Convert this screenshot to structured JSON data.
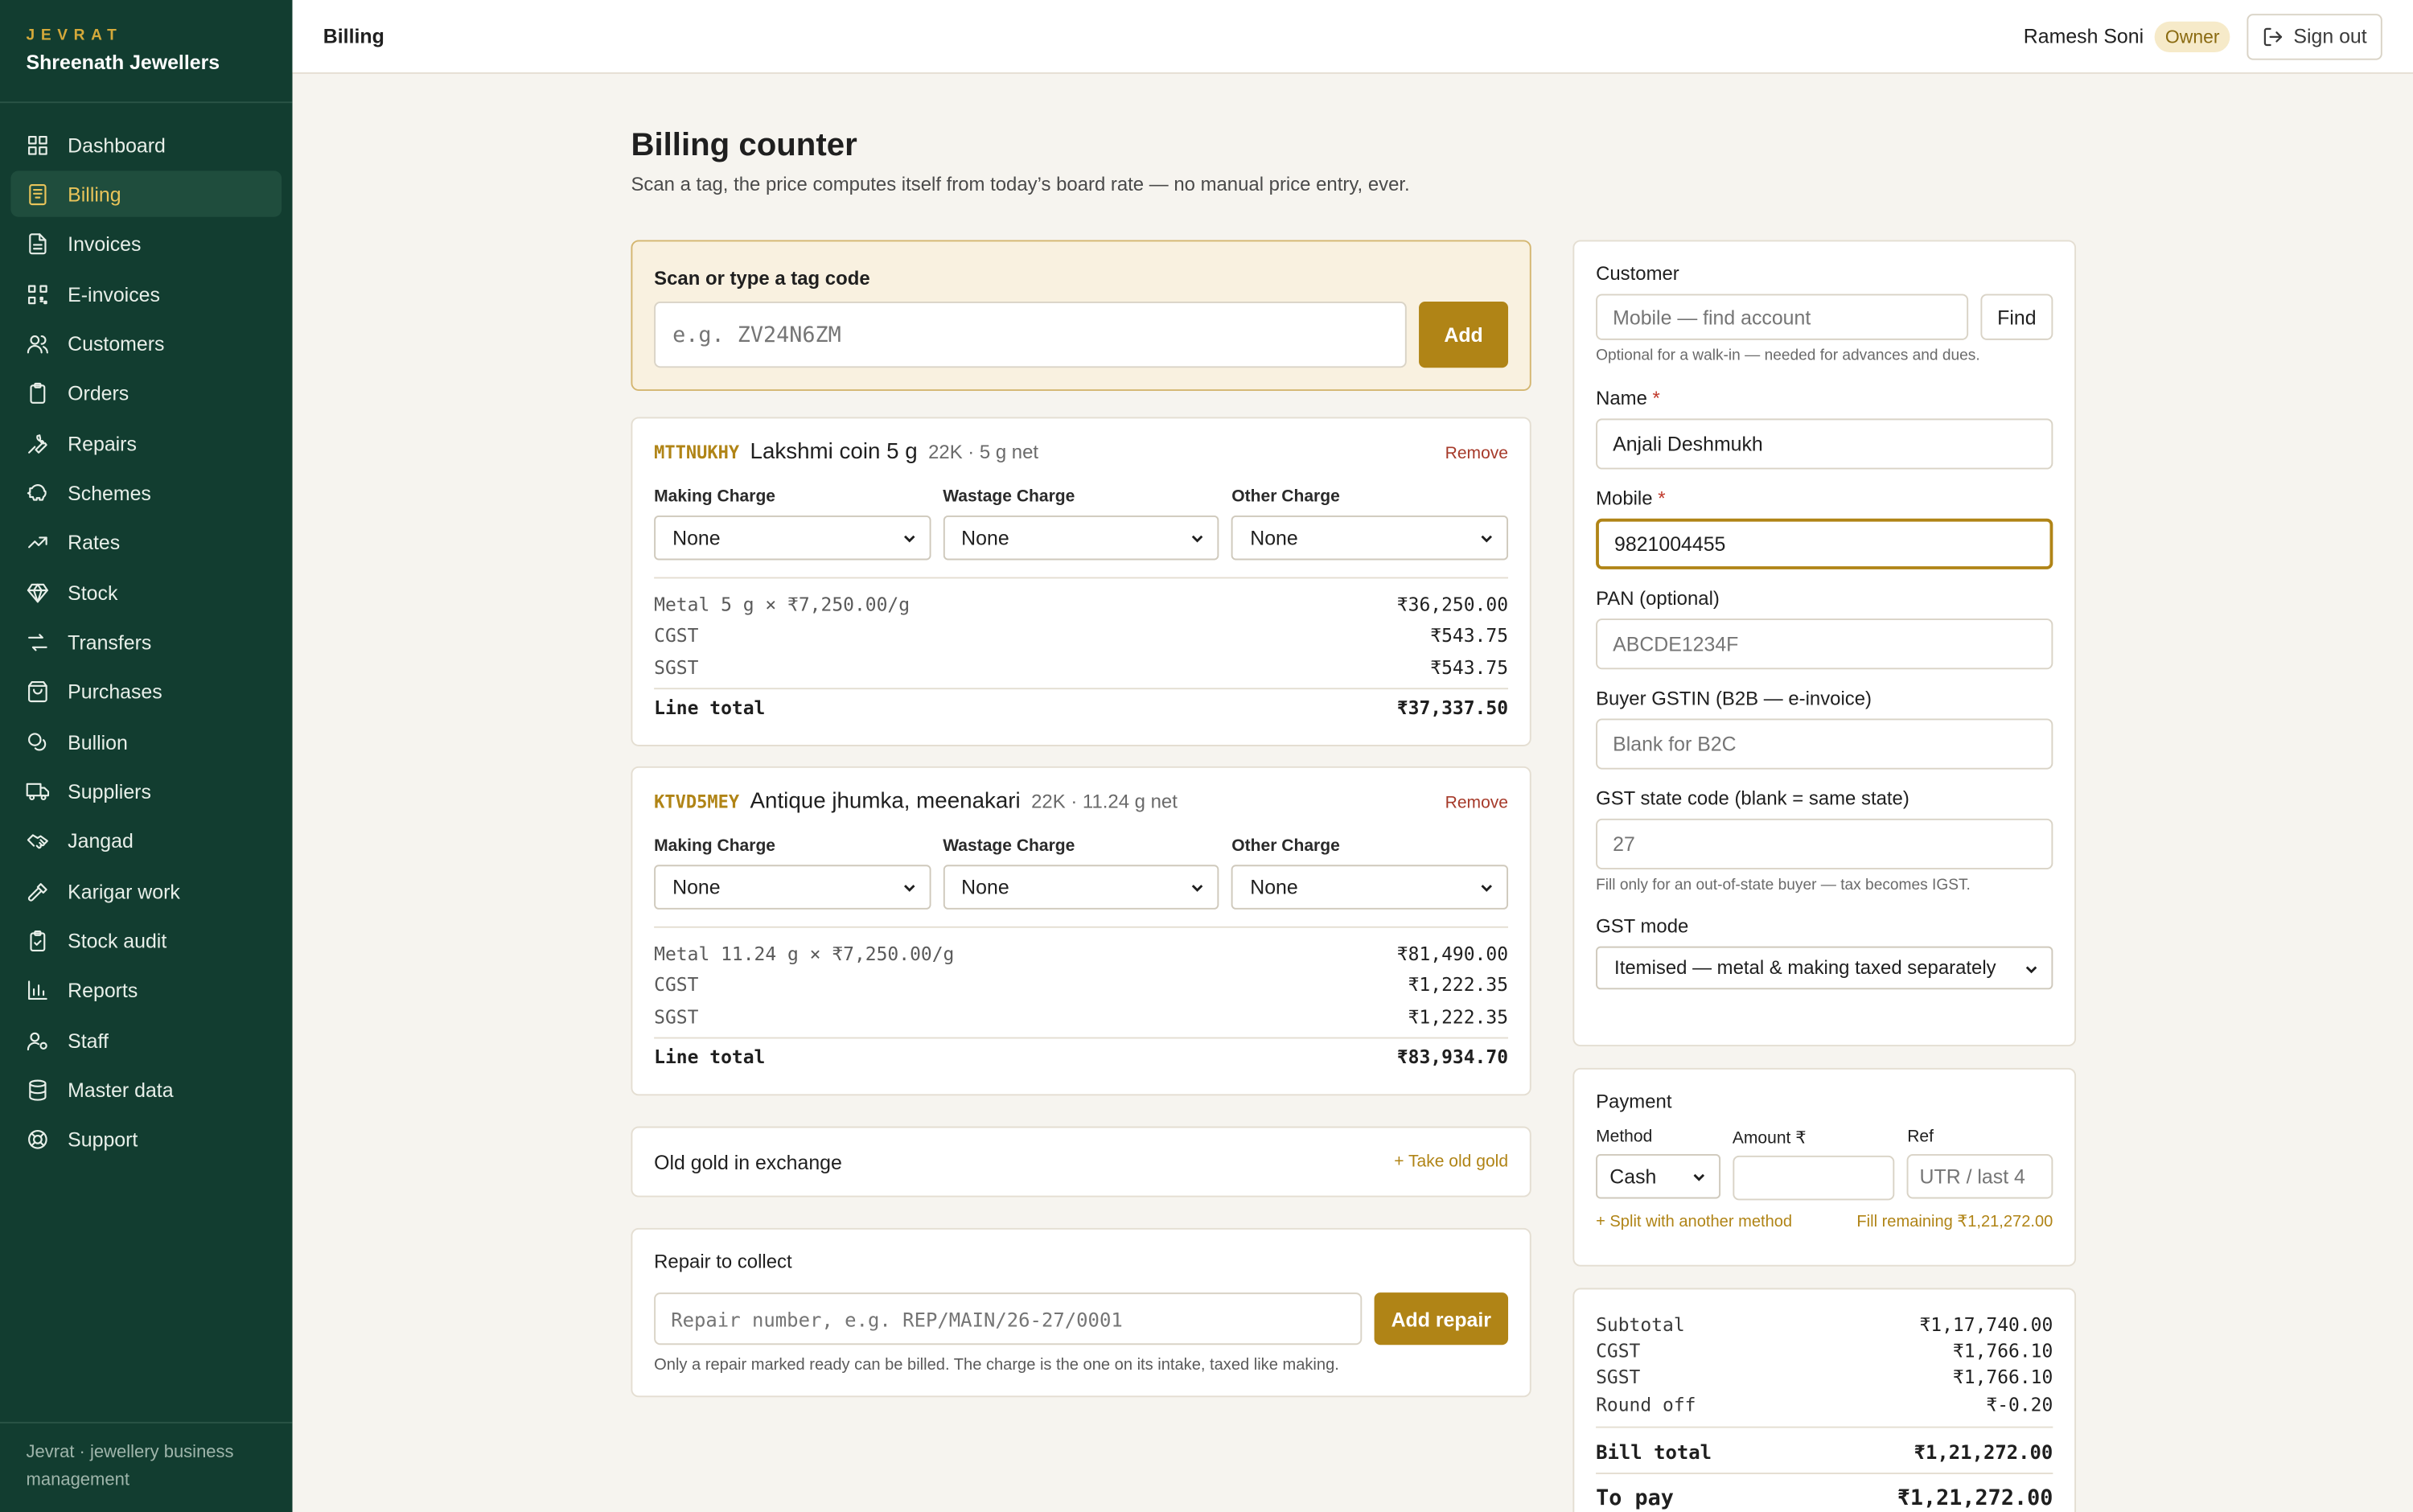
{
  "brand": {
    "mark": "JEVRAT",
    "name": "Shreenath Jewellers",
    "footer": "Jevrat · jewellery business management"
  },
  "nav": [
    {
      "label": "Dashboard",
      "icon": "dashboard-icon"
    },
    {
      "label": "Billing",
      "icon": "billing-icon",
      "active": true
    },
    {
      "label": "Invoices",
      "icon": "invoice-icon"
    },
    {
      "label": "E-invoices",
      "icon": "qr-icon"
    },
    {
      "label": "Customers",
      "icon": "users-icon"
    },
    {
      "label": "Orders",
      "icon": "clipboard-icon"
    },
    {
      "label": "Repairs",
      "icon": "wrench-icon"
    },
    {
      "label": "Schemes",
      "icon": "piggy-bank-icon"
    },
    {
      "label": "Rates",
      "icon": "trending-up-icon"
    },
    {
      "label": "Stock",
      "icon": "gem-icon"
    },
    {
      "label": "Transfers",
      "icon": "arrows-icon"
    },
    {
      "label": "Purchases",
      "icon": "shopping-bag-icon"
    },
    {
      "label": "Bullion",
      "icon": "coins-icon"
    },
    {
      "label": "Suppliers",
      "icon": "truck-icon"
    },
    {
      "label": "Jangad",
      "icon": "handshake-icon"
    },
    {
      "label": "Karigar work",
      "icon": "hammer-icon"
    },
    {
      "label": "Stock audit",
      "icon": "clipboard-check-icon"
    },
    {
      "label": "Reports",
      "icon": "bar-chart-icon"
    },
    {
      "label": "Staff",
      "icon": "user-cog-icon"
    },
    {
      "label": "Master data",
      "icon": "database-icon"
    },
    {
      "label": "Support",
      "icon": "lifebuoy-icon"
    }
  ],
  "topbar": {
    "title": "Billing",
    "user": "Ramesh Soni",
    "role": "Owner",
    "signout": "Sign out"
  },
  "page": {
    "title": "Billing counter",
    "subtitle": "Scan a tag, the price computes itself from today’s board rate — no manual price entry, ever."
  },
  "scan": {
    "label": "Scan or type a tag code",
    "placeholder": "e.g. ZV24N6ZM",
    "button": "Add"
  },
  "items": [
    {
      "tag": "MTTNUKHY",
      "name": "Lakshmi coin 5 g",
      "meta": "22K · 5 g net",
      "remove": "Remove",
      "charges": [
        {
          "label": "Making Charge",
          "value": "None"
        },
        {
          "label": "Wastage Charge",
          "value": "None"
        },
        {
          "label": "Other Charge",
          "value": "None"
        }
      ],
      "lines": [
        {
          "label": "Metal 5 g × ₹7,250.00/g",
          "value": "₹36,250.00"
        },
        {
          "label": "CGST",
          "value": "₹543.75"
        },
        {
          "label": "SGST",
          "value": "₹543.75"
        }
      ],
      "total_label": "Line total",
      "total": "₹37,337.50"
    },
    {
      "tag": "KTVD5MEY",
      "name": "Antique jhumka, meenakari",
      "meta": "22K · 11.24 g net",
      "remove": "Remove",
      "charges": [
        {
          "label": "Making Charge",
          "value": "None"
        },
        {
          "label": "Wastage Charge",
          "value": "None"
        },
        {
          "label": "Other Charge",
          "value": "None"
        }
      ],
      "lines": [
        {
          "label": "Metal 11.24 g × ₹7,250.00/g",
          "value": "₹81,490.00"
        },
        {
          "label": "CGST",
          "value": "₹1,222.35"
        },
        {
          "label": "SGST",
          "value": "₹1,222.35"
        }
      ],
      "total_label": "Line total",
      "total": "₹83,934.70"
    }
  ],
  "oldgold": {
    "title": "Old gold in exchange",
    "link": "+ Take old gold"
  },
  "repair": {
    "title": "Repair to collect",
    "placeholder": "Repair number, e.g. REP/MAIN/26-27/0001",
    "button": "Add repair",
    "hint": "Only a repair marked ready can be billed. The charge is the one on its intake, taxed like making."
  },
  "customer": {
    "title": "Customer",
    "find_placeholder": "Mobile — find account",
    "find_button": "Find",
    "find_hint": "Optional for a walk-in — needed for advances and dues.",
    "name_label": "Name",
    "name_value": "Anjali Deshmukh",
    "mobile_label": "Mobile",
    "mobile_value": "9821004455",
    "pan_label": "PAN (optional)",
    "pan_placeholder": "ABCDE1234F",
    "gstin_label": "Buyer GSTIN (B2B — e-invoice)",
    "gstin_placeholder": "Blank for B2C",
    "state_label": "GST state code (blank = same state)",
    "state_placeholder": "27",
    "state_hint": "Fill only for an out-of-state buyer — tax becomes IGST.",
    "mode_label": "GST mode",
    "mode_value": "Itemised — metal & making taxed separately"
  },
  "payment": {
    "title": "Payment",
    "method_label": "Method",
    "method_value": "Cash",
    "amount_label": "Amount ₹",
    "ref_label": "Ref",
    "ref_placeholder": "UTR / last 4",
    "split_link": "+ Split with another method",
    "fill_link": "Fill remaining ₹1,21,272.00"
  },
  "summary": {
    "rows": [
      {
        "label": "Subtotal",
        "value": "₹1,17,740.00"
      },
      {
        "label": "CGST",
        "value": "₹1,766.10"
      },
      {
        "label": "SGST",
        "value": "₹1,766.10"
      },
      {
        "label": "Round off",
        "value": "₹-0.20"
      }
    ],
    "bill_label": "Bill total",
    "bill_value": "₹1,21,272.00",
    "pay_label": "To pay",
    "pay_value": "₹1,21,272.00"
  },
  "colors": {
    "sidebar": "#123d30",
    "accent": "#b08416",
    "background": "#f6f4ef"
  }
}
